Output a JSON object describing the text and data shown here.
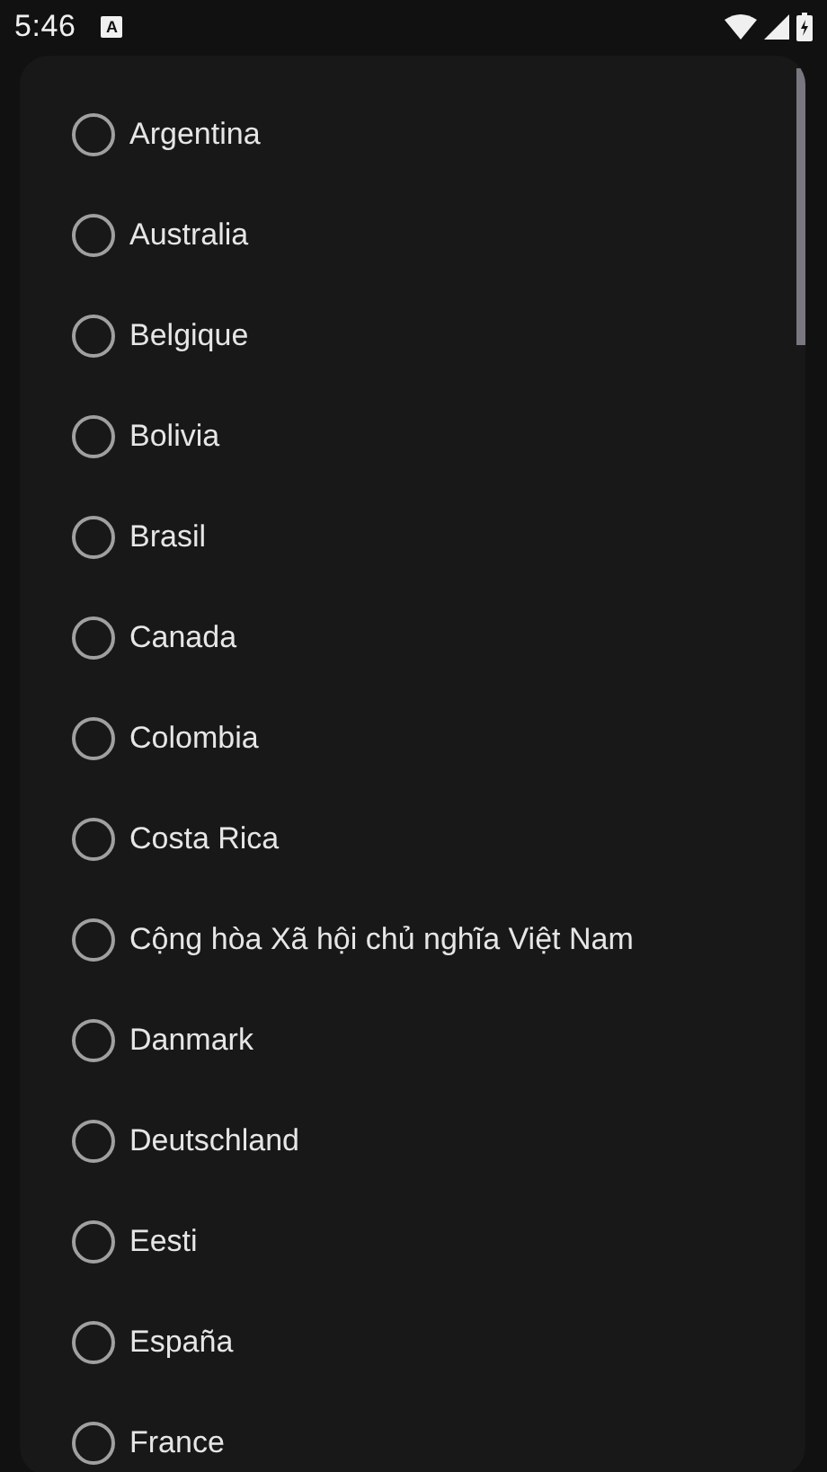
{
  "status_bar": {
    "time": "5:46",
    "notification_glyph": "A"
  },
  "options": [
    {
      "label": "Argentina",
      "selected": false
    },
    {
      "label": "Australia",
      "selected": false
    },
    {
      "label": "Belgique",
      "selected": false
    },
    {
      "label": "Bolivia",
      "selected": false
    },
    {
      "label": "Brasil",
      "selected": false
    },
    {
      "label": "Canada",
      "selected": false
    },
    {
      "label": "Colombia",
      "selected": false
    },
    {
      "label": "Costa Rica",
      "selected": false
    },
    {
      "label": "Cộng hòa Xã hội chủ nghĩa Việt Nam",
      "selected": false
    },
    {
      "label": "Danmark",
      "selected": false
    },
    {
      "label": "Deutschland",
      "selected": false
    },
    {
      "label": "Eesti",
      "selected": false
    },
    {
      "label": "España",
      "selected": false
    },
    {
      "label": "France",
      "selected": false
    }
  ]
}
